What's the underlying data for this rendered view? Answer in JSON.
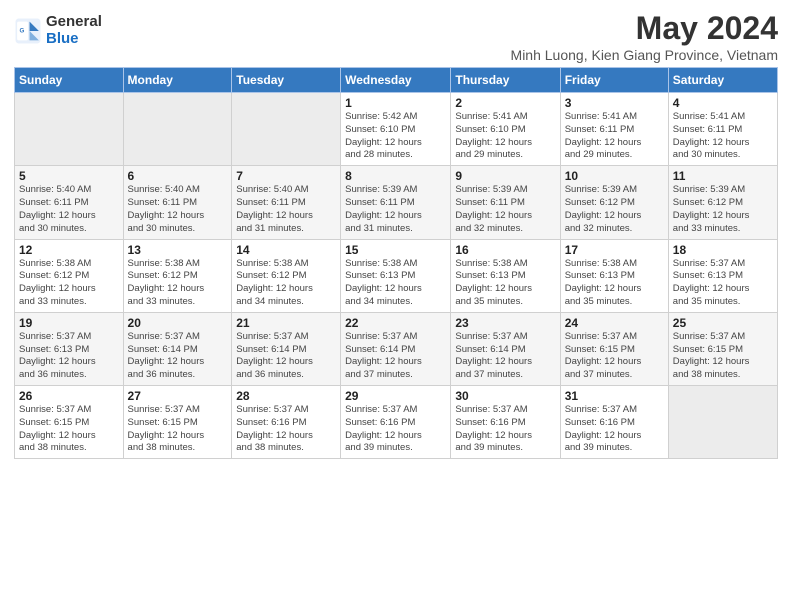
{
  "logo": {
    "general": "General",
    "blue": "Blue"
  },
  "title": "May 2024",
  "subtitle": "Minh Luong, Kien Giang Province, Vietnam",
  "days_of_week": [
    "Sunday",
    "Monday",
    "Tuesday",
    "Wednesday",
    "Thursday",
    "Friday",
    "Saturday"
  ],
  "weeks": [
    [
      {
        "day": "",
        "info": ""
      },
      {
        "day": "",
        "info": ""
      },
      {
        "day": "",
        "info": ""
      },
      {
        "day": "1",
        "info": "Sunrise: 5:42 AM\nSunset: 6:10 PM\nDaylight: 12 hours\nand 28 minutes."
      },
      {
        "day": "2",
        "info": "Sunrise: 5:41 AM\nSunset: 6:10 PM\nDaylight: 12 hours\nand 29 minutes."
      },
      {
        "day": "3",
        "info": "Sunrise: 5:41 AM\nSunset: 6:11 PM\nDaylight: 12 hours\nand 29 minutes."
      },
      {
        "day": "4",
        "info": "Sunrise: 5:41 AM\nSunset: 6:11 PM\nDaylight: 12 hours\nand 30 minutes."
      }
    ],
    [
      {
        "day": "5",
        "info": "Sunrise: 5:40 AM\nSunset: 6:11 PM\nDaylight: 12 hours\nand 30 minutes."
      },
      {
        "day": "6",
        "info": "Sunrise: 5:40 AM\nSunset: 6:11 PM\nDaylight: 12 hours\nand 30 minutes."
      },
      {
        "day": "7",
        "info": "Sunrise: 5:40 AM\nSunset: 6:11 PM\nDaylight: 12 hours\nand 31 minutes."
      },
      {
        "day": "8",
        "info": "Sunrise: 5:39 AM\nSunset: 6:11 PM\nDaylight: 12 hours\nand 31 minutes."
      },
      {
        "day": "9",
        "info": "Sunrise: 5:39 AM\nSunset: 6:11 PM\nDaylight: 12 hours\nand 32 minutes."
      },
      {
        "day": "10",
        "info": "Sunrise: 5:39 AM\nSunset: 6:12 PM\nDaylight: 12 hours\nand 32 minutes."
      },
      {
        "day": "11",
        "info": "Sunrise: 5:39 AM\nSunset: 6:12 PM\nDaylight: 12 hours\nand 33 minutes."
      }
    ],
    [
      {
        "day": "12",
        "info": "Sunrise: 5:38 AM\nSunset: 6:12 PM\nDaylight: 12 hours\nand 33 minutes."
      },
      {
        "day": "13",
        "info": "Sunrise: 5:38 AM\nSunset: 6:12 PM\nDaylight: 12 hours\nand 33 minutes."
      },
      {
        "day": "14",
        "info": "Sunrise: 5:38 AM\nSunset: 6:12 PM\nDaylight: 12 hours\nand 34 minutes."
      },
      {
        "day": "15",
        "info": "Sunrise: 5:38 AM\nSunset: 6:13 PM\nDaylight: 12 hours\nand 34 minutes."
      },
      {
        "day": "16",
        "info": "Sunrise: 5:38 AM\nSunset: 6:13 PM\nDaylight: 12 hours\nand 35 minutes."
      },
      {
        "day": "17",
        "info": "Sunrise: 5:38 AM\nSunset: 6:13 PM\nDaylight: 12 hours\nand 35 minutes."
      },
      {
        "day": "18",
        "info": "Sunrise: 5:37 AM\nSunset: 6:13 PM\nDaylight: 12 hours\nand 35 minutes."
      }
    ],
    [
      {
        "day": "19",
        "info": "Sunrise: 5:37 AM\nSunset: 6:13 PM\nDaylight: 12 hours\nand 36 minutes."
      },
      {
        "day": "20",
        "info": "Sunrise: 5:37 AM\nSunset: 6:14 PM\nDaylight: 12 hours\nand 36 minutes."
      },
      {
        "day": "21",
        "info": "Sunrise: 5:37 AM\nSunset: 6:14 PM\nDaylight: 12 hours\nand 36 minutes."
      },
      {
        "day": "22",
        "info": "Sunrise: 5:37 AM\nSunset: 6:14 PM\nDaylight: 12 hours\nand 37 minutes."
      },
      {
        "day": "23",
        "info": "Sunrise: 5:37 AM\nSunset: 6:14 PM\nDaylight: 12 hours\nand 37 minutes."
      },
      {
        "day": "24",
        "info": "Sunrise: 5:37 AM\nSunset: 6:15 PM\nDaylight: 12 hours\nand 37 minutes."
      },
      {
        "day": "25",
        "info": "Sunrise: 5:37 AM\nSunset: 6:15 PM\nDaylight: 12 hours\nand 38 minutes."
      }
    ],
    [
      {
        "day": "26",
        "info": "Sunrise: 5:37 AM\nSunset: 6:15 PM\nDaylight: 12 hours\nand 38 minutes."
      },
      {
        "day": "27",
        "info": "Sunrise: 5:37 AM\nSunset: 6:15 PM\nDaylight: 12 hours\nand 38 minutes."
      },
      {
        "day": "28",
        "info": "Sunrise: 5:37 AM\nSunset: 6:16 PM\nDaylight: 12 hours\nand 38 minutes."
      },
      {
        "day": "29",
        "info": "Sunrise: 5:37 AM\nSunset: 6:16 PM\nDaylight: 12 hours\nand 39 minutes."
      },
      {
        "day": "30",
        "info": "Sunrise: 5:37 AM\nSunset: 6:16 PM\nDaylight: 12 hours\nand 39 minutes."
      },
      {
        "day": "31",
        "info": "Sunrise: 5:37 AM\nSunset: 6:16 PM\nDaylight: 12 hours\nand 39 minutes."
      },
      {
        "day": "",
        "info": ""
      }
    ]
  ]
}
